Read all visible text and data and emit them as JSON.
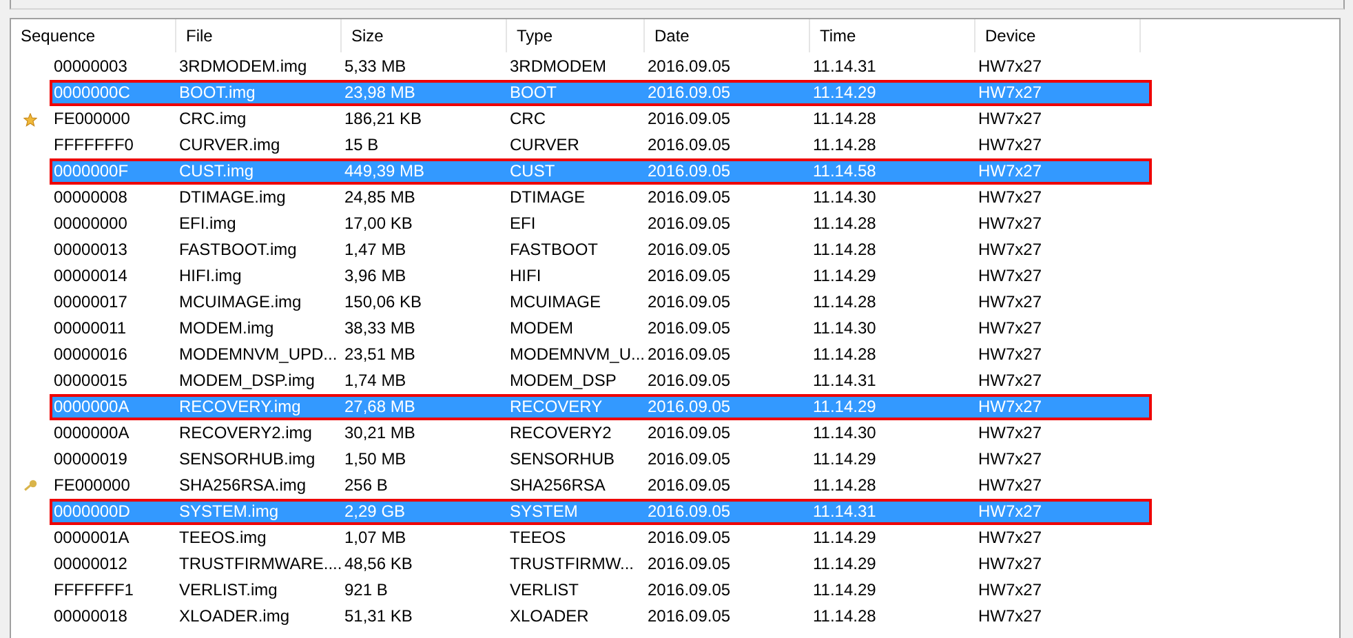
{
  "table": {
    "columns": [
      "Sequence",
      "File",
      "Size",
      "Type",
      "Date",
      "Time",
      "Device"
    ],
    "rows": [
      {
        "kind": "plain",
        "selected": false,
        "cells": [
          "00000003",
          "3RDMODEM.img",
          "5,33 MB",
          "3RDMODEM",
          "2016.09.05",
          "11.14.31",
          "HW7x27"
        ]
      },
      {
        "kind": "plain",
        "selected": true,
        "cells": [
          "0000000C",
          "BOOT.img",
          "23,98 MB",
          "BOOT",
          "2016.09.05",
          "11.14.29",
          "HW7x27"
        ]
      },
      {
        "kind": "starred",
        "selected": false,
        "cells": [
          "FE000000",
          "CRC.img",
          "186,21 KB",
          "CRC",
          "2016.09.05",
          "11.14.28",
          "HW7x27"
        ]
      },
      {
        "kind": "plain",
        "selected": false,
        "cells": [
          "FFFFFFF0",
          "CURVER.img",
          "15 B",
          "CURVER",
          "2016.09.05",
          "11.14.28",
          "HW7x27"
        ]
      },
      {
        "kind": "plain",
        "selected": true,
        "cells": [
          "0000000F",
          "CUST.img",
          "449,39 MB",
          "CUST",
          "2016.09.05",
          "11.14.58",
          "HW7x27"
        ]
      },
      {
        "kind": "plain",
        "selected": false,
        "cells": [
          "00000008",
          "DTIMAGE.img",
          "24,85 MB",
          "DTIMAGE",
          "2016.09.05",
          "11.14.30",
          "HW7x27"
        ]
      },
      {
        "kind": "plain",
        "selected": false,
        "cells": [
          "00000000",
          "EFI.img",
          "17,00 KB",
          "EFI",
          "2016.09.05",
          "11.14.28",
          "HW7x27"
        ]
      },
      {
        "kind": "plain",
        "selected": false,
        "cells": [
          "00000013",
          "FASTBOOT.img",
          "1,47 MB",
          "FASTBOOT",
          "2016.09.05",
          "11.14.28",
          "HW7x27"
        ]
      },
      {
        "kind": "plain",
        "selected": false,
        "cells": [
          "00000014",
          "HIFI.img",
          "3,96 MB",
          "HIFI",
          "2016.09.05",
          "11.14.29",
          "HW7x27"
        ]
      },
      {
        "kind": "plain",
        "selected": false,
        "cells": [
          "00000017",
          "MCUIMAGE.img",
          "150,06 KB",
          "MCUIMAGE",
          "2016.09.05",
          "11.14.28",
          "HW7x27"
        ]
      },
      {
        "kind": "plain",
        "selected": false,
        "cells": [
          "00000011",
          "MODEM.img",
          "38,33 MB",
          "MODEM",
          "2016.09.05",
          "11.14.30",
          "HW7x27"
        ]
      },
      {
        "kind": "plain",
        "selected": false,
        "cells": [
          "00000016",
          "MODEMNVM_UPD...",
          "23,51 MB",
          "MODEMNVM_U...",
          "2016.09.05",
          "11.14.28",
          "HW7x27"
        ]
      },
      {
        "kind": "plain",
        "selected": false,
        "cells": [
          "00000015",
          "MODEM_DSP.img",
          "1,74 MB",
          "MODEM_DSP",
          "2016.09.05",
          "11.14.31",
          "HW7x27"
        ]
      },
      {
        "kind": "plain",
        "selected": true,
        "cells": [
          "0000000A",
          "RECOVERY.img",
          "27,68 MB",
          "RECOVERY",
          "2016.09.05",
          "11.14.29",
          "HW7x27"
        ]
      },
      {
        "kind": "plain",
        "selected": false,
        "cells": [
          "0000000A",
          "RECOVERY2.img",
          "30,21 MB",
          "RECOVERY2",
          "2016.09.05",
          "11.14.30",
          "HW7x27"
        ]
      },
      {
        "kind": "plain",
        "selected": false,
        "cells": [
          "00000019",
          "SENSORHUB.img",
          "1,50 MB",
          "SENSORHUB",
          "2016.09.05",
          "11.14.29",
          "HW7x27"
        ]
      },
      {
        "kind": "keyed",
        "selected": false,
        "cells": [
          "FE000000",
          "SHA256RSA.img",
          "256 B",
          "SHA256RSA",
          "2016.09.05",
          "11.14.28",
          "HW7x27"
        ]
      },
      {
        "kind": "plain",
        "selected": true,
        "cells": [
          "0000000D",
          "SYSTEM.img",
          "2,29 GB",
          "SYSTEM",
          "2016.09.05",
          "11.14.31",
          "HW7x27"
        ]
      },
      {
        "kind": "plain",
        "selected": false,
        "cells": [
          "0000001A",
          "TEEOS.img",
          "1,07 MB",
          "TEEOS",
          "2016.09.05",
          "11.14.29",
          "HW7x27"
        ]
      },
      {
        "kind": "plain",
        "selected": false,
        "cells": [
          "00000012",
          "TRUSTFIRMWARE....",
          "48,56 KB",
          "TRUSTFIRMW...",
          "2016.09.05",
          "11.14.29",
          "HW7x27"
        ]
      },
      {
        "kind": "plain",
        "selected": false,
        "cells": [
          "FFFFFFF1",
          "VERLIST.img",
          "921 B",
          "VERLIST",
          "2016.09.05",
          "11.14.29",
          "HW7x27"
        ]
      },
      {
        "kind": "plain",
        "selected": false,
        "cells": [
          "00000018",
          "XLOADER.img",
          "51,31 KB",
          "XLOADER",
          "2016.09.05",
          "11.14.28",
          "HW7x27"
        ]
      }
    ]
  }
}
